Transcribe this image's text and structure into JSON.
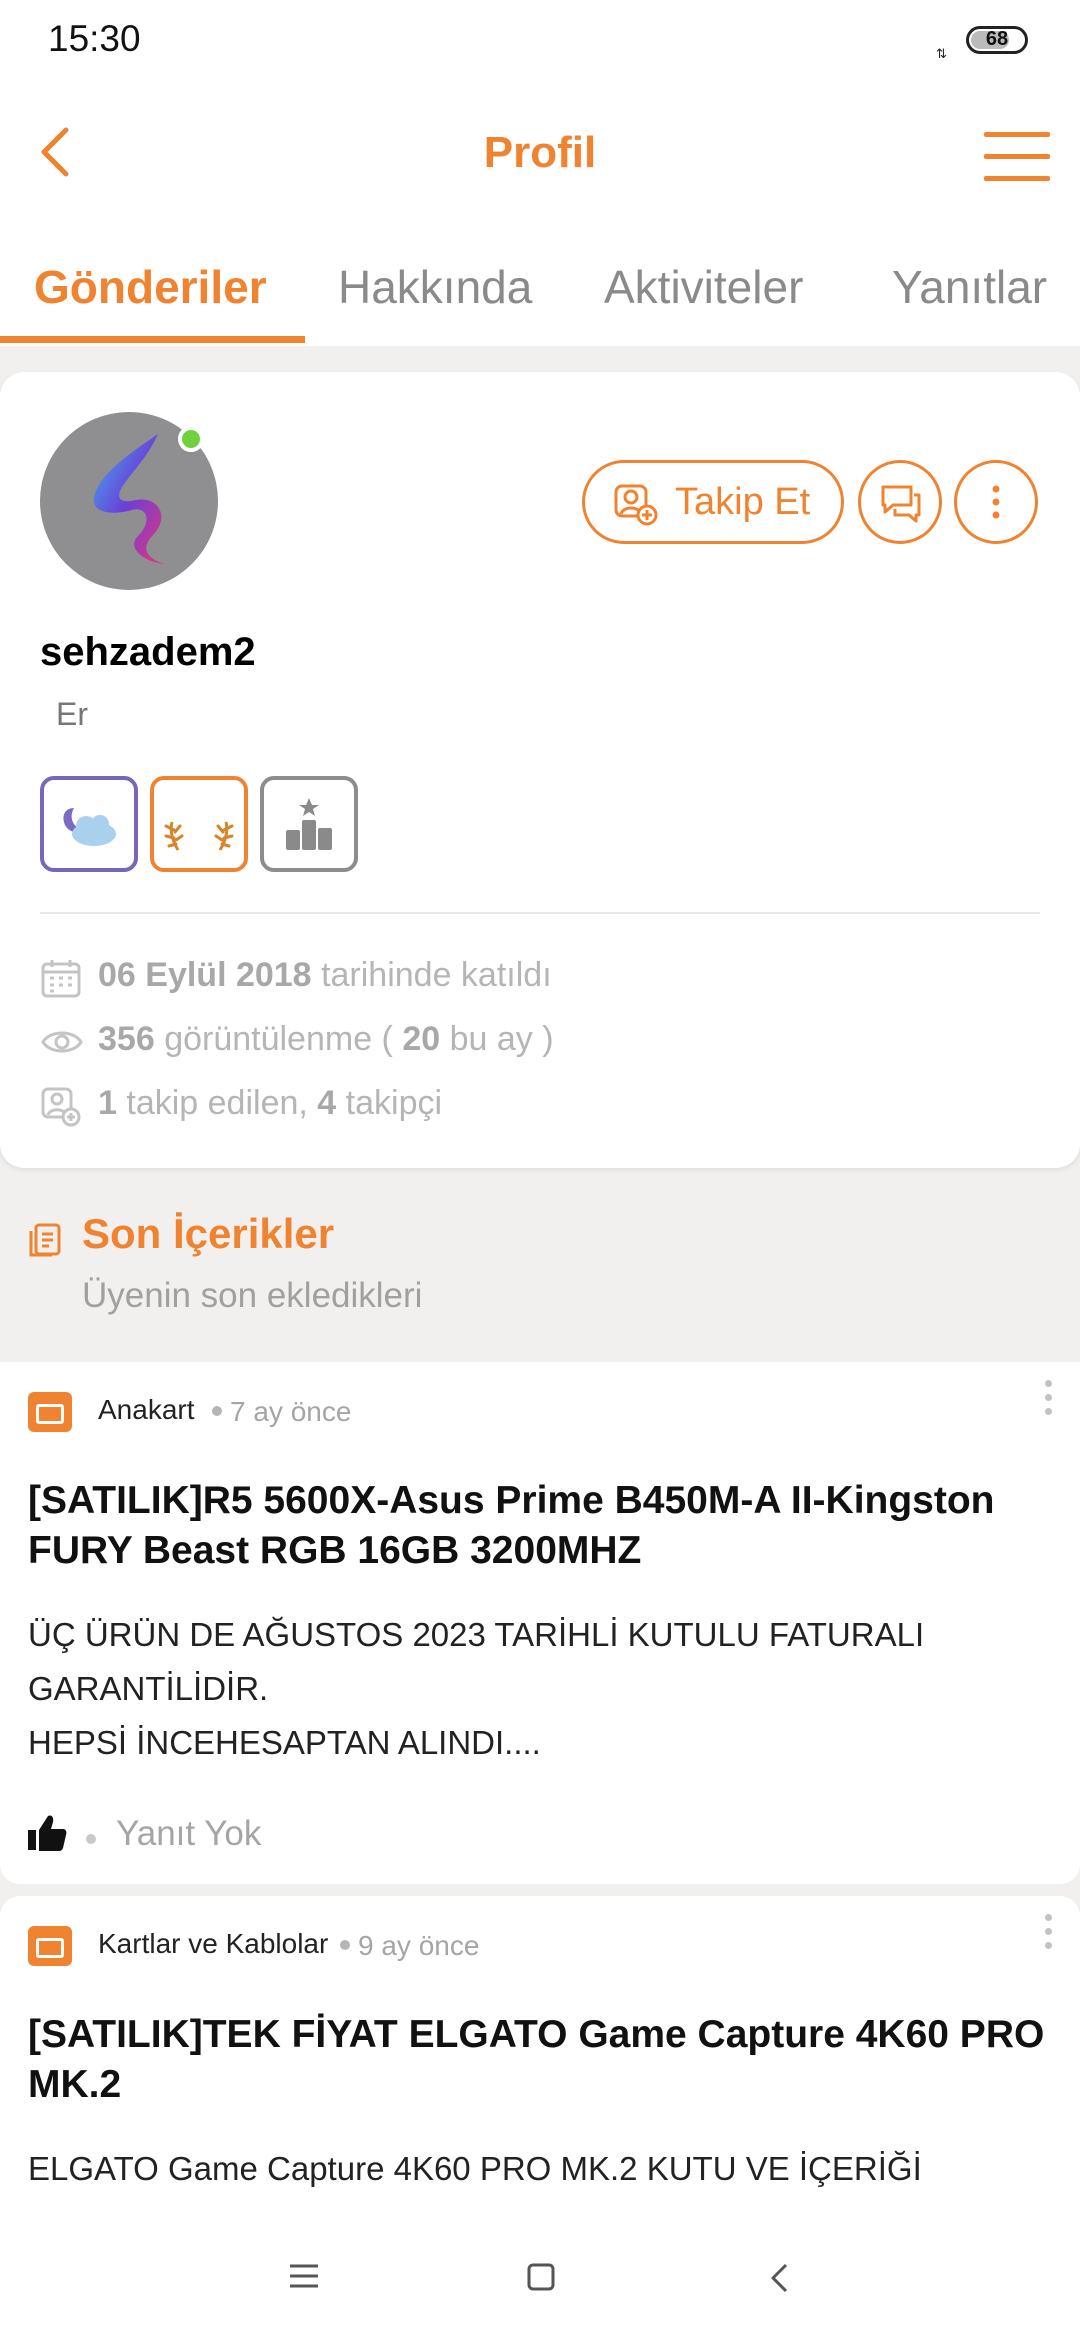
{
  "status": {
    "time": "15:30",
    "battery": "68"
  },
  "header": {
    "title": "Profil"
  },
  "tabs": [
    {
      "label": "Gönderiler"
    },
    {
      "label": "Hakkında"
    },
    {
      "label": "Aktiviteler"
    },
    {
      "label": "Yanıtlar"
    }
  ],
  "profile": {
    "username": "sehzadem2",
    "rank": "Er",
    "follow_label": "Takip Et",
    "joined": {
      "date": "06 Eylül 2018",
      "suffix": "tarihinde katıldı"
    },
    "views": {
      "total": "356",
      "label": "görüntülenme (",
      "month": "20",
      "month_label": "bu ay )"
    },
    "follow": {
      "following": "1",
      "following_label": "takip edilen,",
      "followers": "4",
      "followers_label": "takipçi"
    }
  },
  "section": {
    "title": "Son İçerikler",
    "subtitle": "Üyenin son ekledikleri"
  },
  "posts": [
    {
      "category": "Anakart",
      "ago": "7 ay önce",
      "title": "[SATILIK]R5 5600X-Asus Prime B450M-A II-Kingston FURY Beast RGB 16GB 3200MHZ",
      "excerpt": "ÜÇ ÜRÜN DE AĞUSTOS 2023 TARİHLİ KUTULU FATURALI GARANTİLİDİR.\nHEPSİ İNCEHESAPTAN ALINDI....",
      "replies": "Yanıt Yok"
    },
    {
      "category": "Kartlar ve Kablolar",
      "ago": "9 ay önce",
      "title": "[SATILIK]TEK FİYAT ELGATO Game Capture 4K60 PRO MK.2",
      "excerpt": "ELGATO Game Capture 4K60 PRO MK.2  KUTU VE İÇERİĞİ"
    }
  ],
  "colors": {
    "accent": "#f0832f",
    "badge_purple": "#7a66b8",
    "badge_gray": "#8c8c8c",
    "online": "#6fd23c"
  }
}
